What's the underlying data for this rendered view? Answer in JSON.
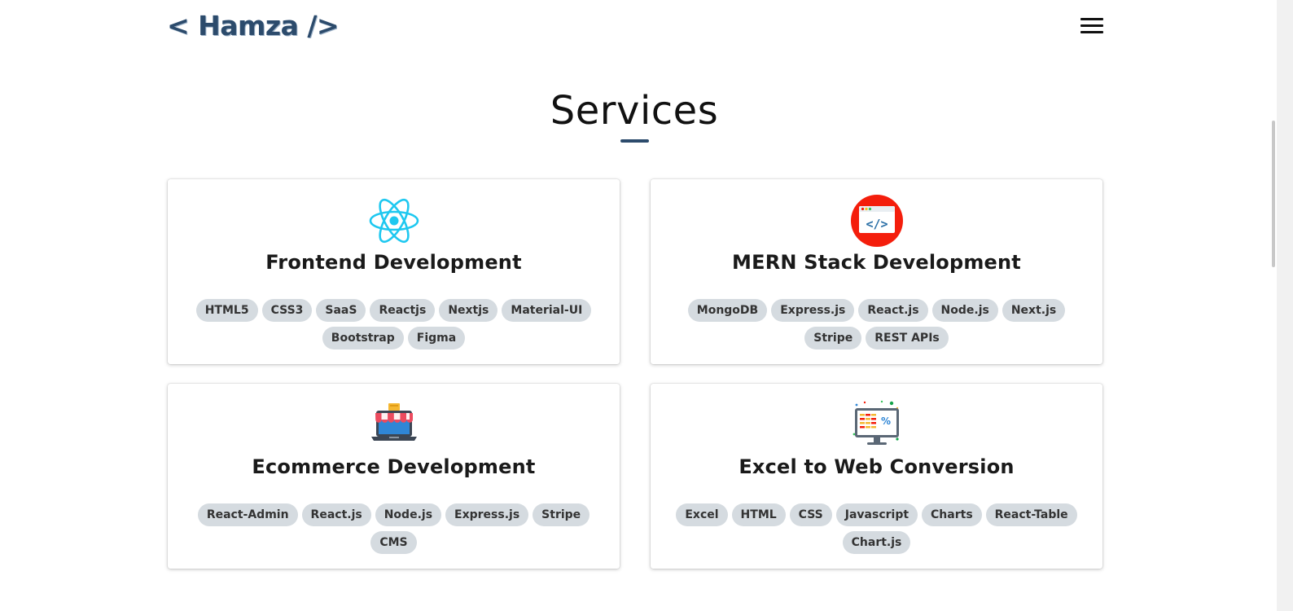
{
  "header": {
    "logo_text": "< Hamza />",
    "menu_icon": "hamburger-menu-icon"
  },
  "services": {
    "title": "Services",
    "accent_color": "#2c4b6c",
    "cards": [
      {
        "title": "Frontend Development",
        "icon": "react-atom-icon",
        "tags": [
          "HTML5",
          "CSS3",
          "SaaS",
          "Reactjs",
          "Nextjs",
          "Material-UI",
          "Bootstrap",
          "Figma"
        ]
      },
      {
        "title": "MERN Stack Development",
        "icon": "code-window-icon",
        "tags": [
          "MongoDB",
          "Express.js",
          "React.js",
          "Node.js",
          "Next.js",
          "Stripe",
          "REST APIs"
        ]
      },
      {
        "title": "Ecommerce Development",
        "icon": "laptop-storefront-icon",
        "tags": [
          "React-Admin",
          "React.js",
          "Node.js",
          "Express.js",
          "Stripe",
          "CMS"
        ]
      },
      {
        "title": "Excel to Web Conversion",
        "icon": "monitor-spreadsheet-icon",
        "tags": [
          "Excel",
          "HTML",
          "CSS",
          "Javascript",
          "Charts",
          "React-Table",
          "Chart.js"
        ]
      }
    ]
  }
}
